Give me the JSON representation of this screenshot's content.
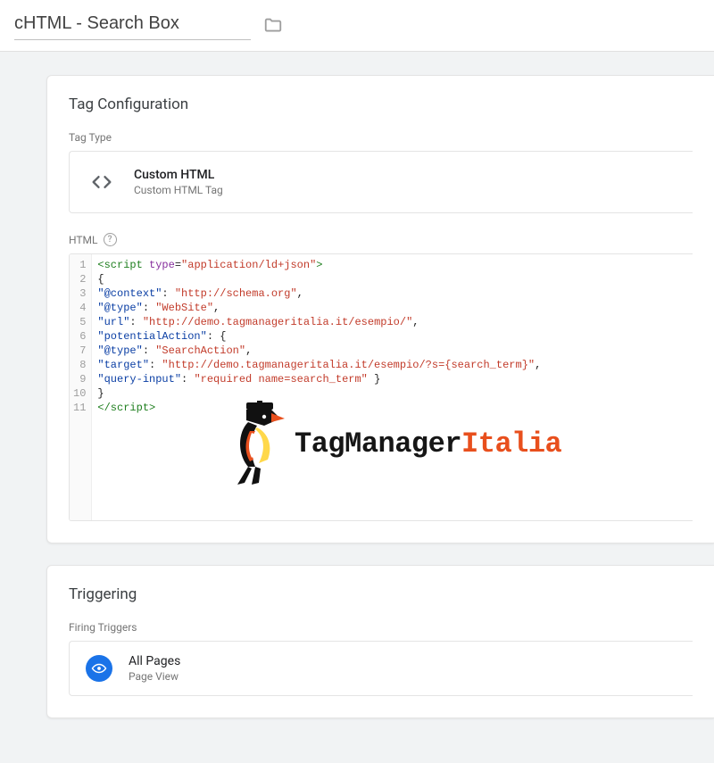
{
  "header": {
    "title": "cHTML - Search Box"
  },
  "tag_config": {
    "section_title": "Tag Configuration",
    "tag_type_label": "Tag Type",
    "tag_type": {
      "name": "Custom HTML",
      "description": "Custom HTML Tag"
    },
    "html_label": "HTML",
    "code_lines": [
      {
        "n": 1,
        "t": "open",
        "tag": "script",
        "attr": "type",
        "val": "application/ld+json"
      },
      {
        "n": 2,
        "t": "brace",
        "text": "{"
      },
      {
        "n": 3,
        "t": "kv",
        "key": "@context",
        "val": "http://schema.org",
        "comma": true
      },
      {
        "n": 4,
        "t": "kv",
        "key": "@type",
        "val": "WebSite",
        "comma": true
      },
      {
        "n": 5,
        "t": "kv",
        "key": "url",
        "val": "http://demo.tagmanageritalia.it/esempio/",
        "comma": true
      },
      {
        "n": 6,
        "t": "kobj",
        "key": "potentialAction"
      },
      {
        "n": 7,
        "t": "kv",
        "key": "@type",
        "val": "SearchAction",
        "comma": true
      },
      {
        "n": 8,
        "t": "kv",
        "key": "target",
        "val": "http://demo.tagmanageritalia.it/esempio/?s={search_term}",
        "comma": true
      },
      {
        "n": 9,
        "t": "kvend",
        "key": "query-input",
        "val": "required name=search_term"
      },
      {
        "n": 10,
        "t": "brace",
        "text": "}"
      },
      {
        "n": 11,
        "t": "close",
        "tag": "script"
      }
    ],
    "watermark": {
      "part1": "TagManager",
      "part2": "Italia"
    }
  },
  "triggering": {
    "section_title": "Triggering",
    "firing_label": "Firing Triggers",
    "trigger": {
      "name": "All Pages",
      "type": "Page View"
    }
  }
}
